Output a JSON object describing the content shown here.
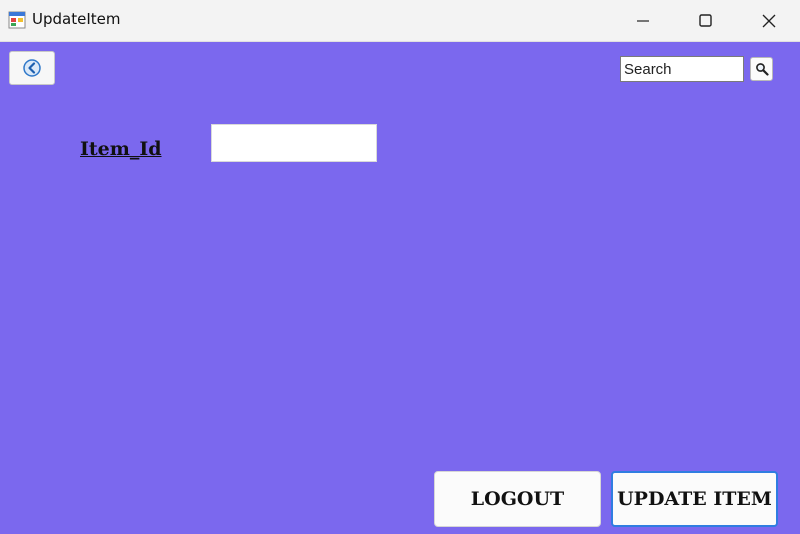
{
  "window": {
    "title": "UpdateItem",
    "app_icon": "app-form-icon"
  },
  "toolbar": {
    "back_icon": "back-arrow-icon",
    "search_value": "Search",
    "search_icon": "magnifier-icon"
  },
  "form": {
    "item_id_label": "Item_Id",
    "item_id_value": ""
  },
  "buttons": {
    "logout_label": "LOGOUT",
    "update_label": "UPDATE ITEM"
  },
  "colors": {
    "background": "#7b68ee",
    "focus_border": "#2f7de1"
  }
}
